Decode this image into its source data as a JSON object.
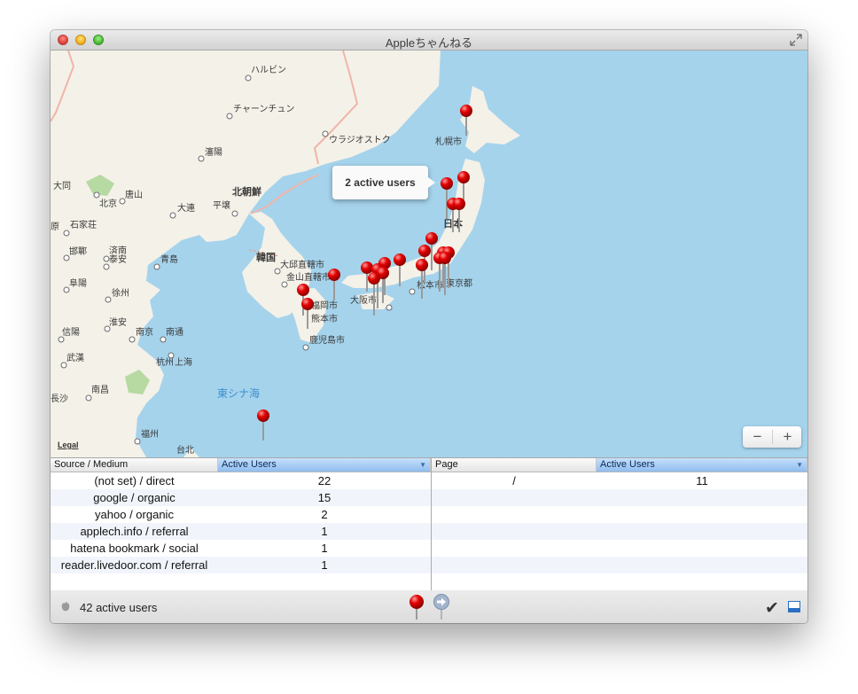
{
  "window": {
    "title": "Appleちゃんねる"
  },
  "map": {
    "legal": "Legal",
    "callout": "2 active users",
    "zoom_out": "−",
    "zoom_in": "+",
    "labels": {
      "harbin": "ハルビン",
      "changchun": "チャーンチュン",
      "vladivostok": "ウラジオストク",
      "shenyang": "瀋陽",
      "sapporo": "札幌市",
      "datong": "大同",
      "tangshan": "唐山",
      "beijing": "北京",
      "dalian": "大連",
      "north_korea": "北朝鮮",
      "pyongyang": "平壌",
      "japan": "日本",
      "shijiazhuang": "石家荘",
      "handan": "邯鄲",
      "jinan": "済南",
      "taian": "泰安",
      "qingdao": "青島",
      "korea": "韓国",
      "daegu": "大邱直轄市",
      "busan": "金山直轄市",
      "osaka": "大阪市",
      "matsumoto": "松本市",
      "tokyo": "東京都",
      "fuyang": "阜陽",
      "xuzhou": "徐州",
      "fukuoka": "福岡市",
      "kumamoto": "熊本市",
      "huaian": "淮安",
      "xinyang": "信陽",
      "nanjing": "南京",
      "nantong": "南通",
      "kagoshima": "鹿児島市",
      "wuhan": "武漢",
      "hangzhou": "杭州",
      "shanghai": "上海",
      "east_china_sea": "東シナ海",
      "changsha": "長沙",
      "nanchang": "南昌",
      "fuzhou": "福州",
      "taipei": "台北",
      "yuan": "原"
    }
  },
  "source_table": {
    "headers": [
      "Source / Medium",
      "Active Users"
    ],
    "rows": [
      [
        "(not set) / direct",
        "22"
      ],
      [
        "google / organic",
        "15"
      ],
      [
        "yahoo / organic",
        "2"
      ],
      [
        "applech.info / referral",
        "1"
      ],
      [
        "hatena bookmark / social",
        "1"
      ],
      [
        "reader.livedoor.com / referral",
        "1"
      ]
    ]
  },
  "page_table": {
    "headers": [
      "Page",
      "Active Users"
    ],
    "rows": [
      [
        "/",
        "11"
      ]
    ]
  },
  "status": {
    "active_users": "42 active users"
  },
  "icons": {
    "status": "apple-icon",
    "left_button": "pin-icon",
    "right_button": "arrow-right-icon",
    "confirm": "checkmark-icon",
    "toggle": "panel-icon"
  },
  "colors": {
    "sea": "#a5d3ec",
    "land": "#f4f1e8",
    "pin": "#e30000",
    "selected_header": "#8fbdf0"
  }
}
